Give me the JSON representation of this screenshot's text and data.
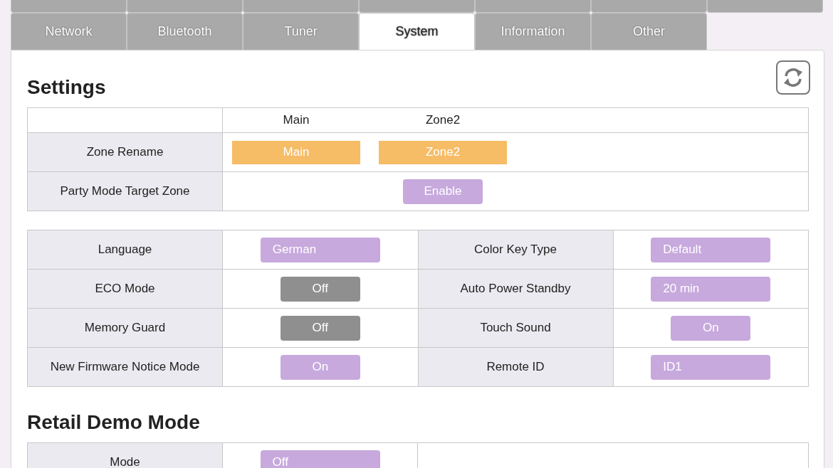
{
  "top_tabs": [
    {
      "selected": false
    },
    {
      "selected": false
    },
    {
      "selected": false
    },
    {
      "selected": false
    },
    {
      "selected": false
    },
    {
      "selected": false
    },
    {
      "selected": false
    }
  ],
  "tabs": [
    {
      "label": "Network",
      "selected": false
    },
    {
      "label": "Bluetooth",
      "selected": false
    },
    {
      "label": "Tuner",
      "selected": false
    },
    {
      "label": "System",
      "selected": true
    },
    {
      "label": "Information",
      "selected": false
    },
    {
      "label": "Other",
      "selected": false
    }
  ],
  "settings": {
    "title": "Settings",
    "zones": [
      "Main",
      "Zone2"
    ],
    "zone_rows": [
      {
        "label": "Zone Rename",
        "cells": [
          {
            "kind": "name",
            "label": "Main"
          },
          {
            "kind": "name",
            "label": "Zone2"
          }
        ]
      },
      {
        "label": "Party Mode Target Zone",
        "cells": [
          {
            "kind": "empty"
          },
          {
            "kind": "toggle",
            "label": "Enable"
          }
        ]
      }
    ],
    "rows": [
      [
        {
          "label": "Language",
          "kind": "select",
          "value": "German"
        },
        {
          "label": "Color Key Type",
          "kind": "select",
          "value": "Default"
        }
      ],
      [
        {
          "label": "ECO Mode",
          "kind": "toggle",
          "value": "Off",
          "on": false
        },
        {
          "label": "Auto Power Standby",
          "kind": "select",
          "value": "20 min"
        }
      ],
      [
        {
          "label": "Memory Guard",
          "kind": "toggle",
          "value": "Off",
          "on": false
        },
        {
          "label": "Touch Sound",
          "kind": "toggle",
          "value": "On",
          "on": true
        }
      ],
      [
        {
          "label": "New Firmware Notice Mode",
          "kind": "toggle",
          "value": "On",
          "on": true
        },
        {
          "label": "Remote ID",
          "kind": "select",
          "value": "ID1"
        }
      ]
    ]
  },
  "retail_demo": {
    "title": "Retail Demo Mode",
    "rows": [
      {
        "label": "Mode",
        "kind": "select",
        "value": "Off"
      }
    ]
  }
}
